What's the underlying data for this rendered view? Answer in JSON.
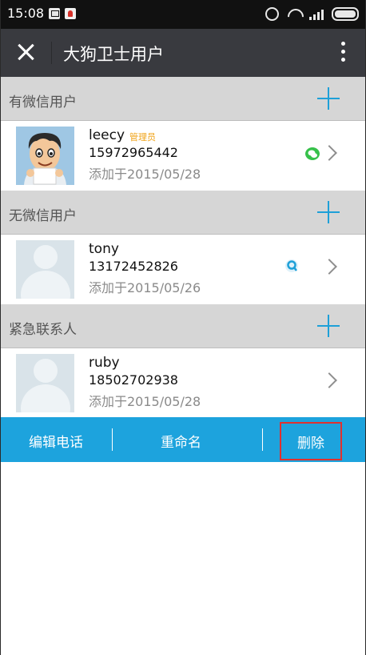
{
  "status_bar": {
    "time": "15:08"
  },
  "header": {
    "title": "大狗卫士用户"
  },
  "sections": [
    {
      "label": "有微信用户",
      "contact": {
        "name": "leecy",
        "badge": "管理员",
        "phone": "15972965442",
        "added": "添加于2015/05/28",
        "indicator": "wechat-icon"
      }
    },
    {
      "label": "无微信用户",
      "contact": {
        "name": "tony",
        "phone": "13172452826",
        "added": "添加于2015/05/26",
        "indicator": "qq-icon"
      }
    },
    {
      "label": "紧急联系人",
      "contact": {
        "name": "ruby",
        "phone": "18502702938",
        "added": "添加于2015/05/28"
      }
    }
  ],
  "actions": {
    "edit_phone": "编辑电话",
    "rename": "重命名",
    "delete": "删除"
  },
  "colors": {
    "accent": "#1da3dd",
    "titlebar": "#393a3f",
    "badge": "#f0a317",
    "highlight_border": "#e0302e"
  }
}
